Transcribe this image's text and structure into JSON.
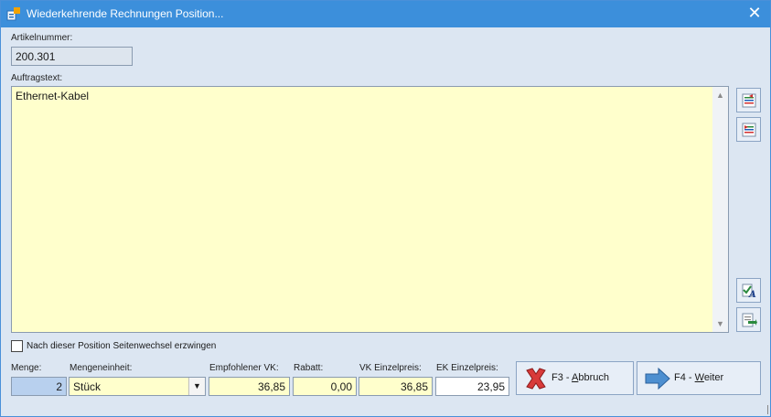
{
  "window": {
    "title": "Wiederkehrende Rechnungen Position...",
    "close_glyph": "✕"
  },
  "article": {
    "label": "Artikelnummer:",
    "value": "200.301"
  },
  "order_text": {
    "label": "Auftragstext:",
    "value": "Ethernet-Kabel"
  },
  "page_break": {
    "label": "Nach dieser Position Seitenwechsel erzwingen",
    "checked": false
  },
  "quantity": {
    "label": "Menge:",
    "value": "2"
  },
  "unit": {
    "label": "Mengeneinheit:",
    "value": "Stück"
  },
  "recommended_price": {
    "label": "Empfohlener VK:",
    "value": "36,85"
  },
  "discount": {
    "label": "Rabatt:",
    "value": "0,00"
  },
  "sale_price": {
    "label": "VK Einzelpreis:",
    "value": "36,85"
  },
  "purchase_price": {
    "label": "EK Einzelpreis:",
    "value": "23,95"
  },
  "buttons": {
    "cancel_prefix": "F3 - ",
    "cancel_hotkey": "A",
    "cancel_rest": "bbruch",
    "next_prefix": "F4 - ",
    "next_hotkey": "W",
    "next_rest": "eiter"
  },
  "icons": {
    "app": "app-icon",
    "side_1": "text-insert-icon",
    "side_2": "text-remove-icon",
    "side_3": "spellcheck-icon",
    "side_4": "export-icon",
    "cancel": "red-x-icon",
    "next": "right-arrow-icon"
  },
  "colors": {
    "titlebar": "#3c8fdb",
    "input_yellow": "#ffffcc",
    "quantity_blue": "#b8d0ee"
  }
}
